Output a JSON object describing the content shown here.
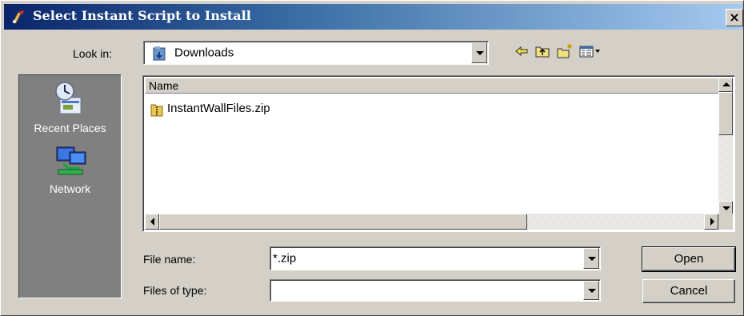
{
  "window": {
    "title": "Select Instant Script to Install",
    "close_glyph": "×"
  },
  "lookin": {
    "label": "Look in:",
    "value": "Downloads",
    "folder_icon": "downloads-folder-icon"
  },
  "toolbar": {
    "icons": [
      "back-icon",
      "up-folder-icon",
      "new-folder-icon",
      "view-menu-icon"
    ]
  },
  "places": [
    {
      "label": "Recent Places",
      "icon": "recent-places-icon"
    },
    {
      "label": "Network",
      "icon": "network-icon"
    }
  ],
  "filelist": {
    "column_header": "Name",
    "files": [
      {
        "name": "InstantWallFiles.zip",
        "icon": "zip-folder-icon"
      }
    ]
  },
  "filename": {
    "label": "File name:",
    "value": "*.zip"
  },
  "filetype": {
    "label": "Files of type:",
    "value": ""
  },
  "buttons": {
    "open": "Open",
    "cancel": "Cancel"
  },
  "colors": {
    "titlebar_start": "#0a246a",
    "titlebar_end": "#a6caf0",
    "face": "#d4d0c8",
    "places_bg": "#808080"
  }
}
